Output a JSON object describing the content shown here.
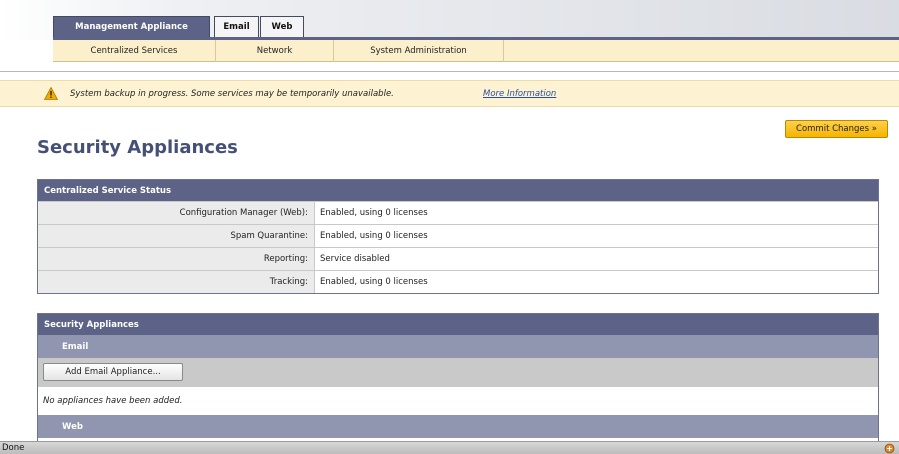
{
  "tabs": [
    {
      "label": "Management Appliance"
    },
    {
      "label": "Email"
    },
    {
      "label": "Web"
    }
  ],
  "subnav": [
    {
      "label": "Centralized Services"
    },
    {
      "label": "Network"
    },
    {
      "label": "System Administration"
    }
  ],
  "warning": {
    "icon": "warning-icon",
    "text": "System backup in progress. Some services may be temporarily unavailable.",
    "link": "More Information"
  },
  "commit_button": "Commit Changes »",
  "page_title": "Security Appliances",
  "status_panel": {
    "title": "Centralized Service Status",
    "rows": [
      {
        "label": "Configuration Manager (Web):",
        "value": "Enabled, using 0 licenses"
      },
      {
        "label": "Spam Quarantine:",
        "value": "Enabled, using 0 licenses"
      },
      {
        "label": "Reporting:",
        "value": "Service disabled"
      },
      {
        "label": "Tracking:",
        "value": "Enabled, using 0 licenses"
      }
    ]
  },
  "appliances_panel": {
    "title": "Security Appliances",
    "email_section": "Email",
    "add_button": "Add Email Appliance...",
    "empty_text": "No appliances have been added.",
    "web_section": "Web"
  },
  "status_bar": {
    "text": "Done"
  },
  "colors": {
    "accent": "#5c6386",
    "subnav": "#fbf0cb",
    "commit": "#f5b400",
    "title": "#465076"
  }
}
